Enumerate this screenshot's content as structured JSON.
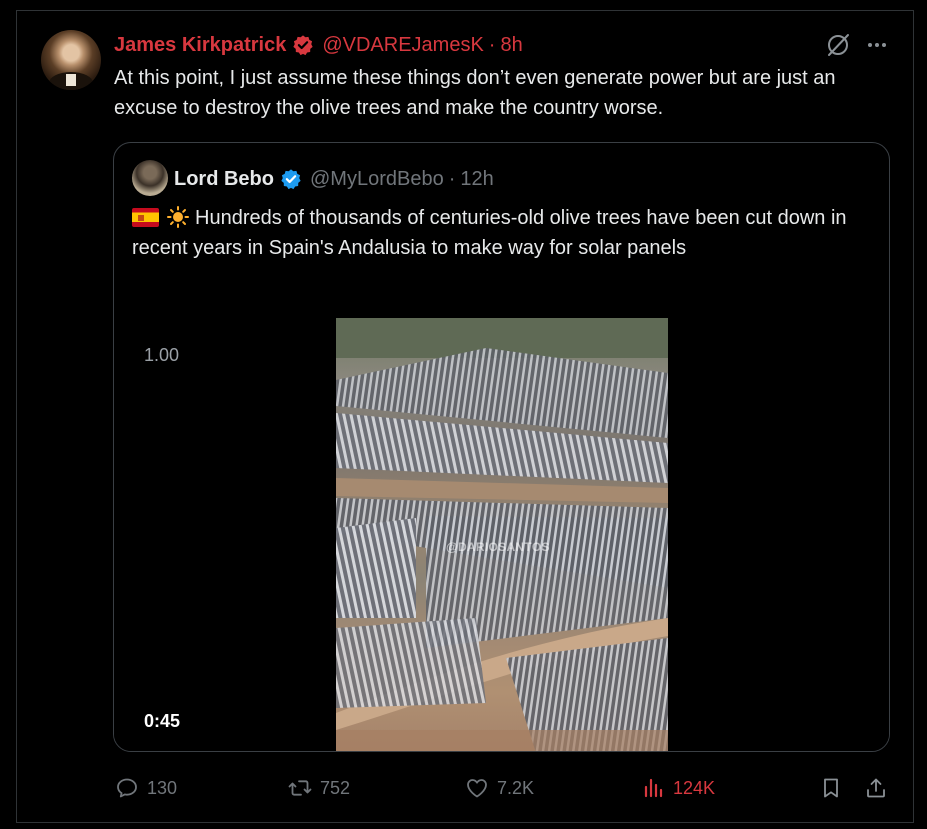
{
  "tweet": {
    "author_name": "James Kirkpatrick",
    "handle": "@VDAREJamesK",
    "separator": "·",
    "time": "8h",
    "text": "At this point, I just assume these things don’t even generate power but are just an excuse to destroy the olive trees and make the country worse."
  },
  "quote": {
    "author_name": "Lord Bebo",
    "handle": "@MyLordBebo",
    "separator": "·",
    "time": "12h",
    "text": "Hundreds of thousands of centuries-old olive trees have been cut down in recent years in Spain's Andalusia to make way for solar panels",
    "video": {
      "speed": "1.00",
      "duration": "0:45",
      "watermark": "@DARIOSANTOS"
    }
  },
  "actions": {
    "replies": "130",
    "reposts": "752",
    "likes": "7.2K",
    "views": "124K"
  },
  "colors": {
    "accent_red": "#d8383f",
    "verified_blue": "#1d9bf0",
    "muted": "#71767b"
  }
}
